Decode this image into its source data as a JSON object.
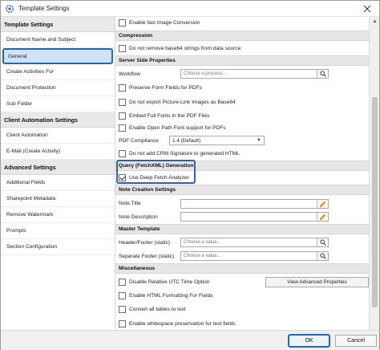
{
  "window": {
    "title": "Template Settings",
    "close_glyph": "✕"
  },
  "sidebar": {
    "sections": [
      {
        "title": "Template Settings",
        "items": [
          {
            "label": "Document Name and Subject",
            "selected": false
          },
          {
            "label": "General",
            "selected": true
          },
          {
            "label": "Create Activities For",
            "selected": false
          },
          {
            "label": "Document Protection",
            "selected": false
          },
          {
            "label": "Sub Folder",
            "selected": false
          }
        ]
      },
      {
        "title": "Client Automation Settings",
        "items": [
          {
            "label": "Client Automation",
            "selected": false
          },
          {
            "label": "E-Mail (Create Activity)",
            "selected": false
          }
        ]
      },
      {
        "title": "Advanced Settings",
        "items": [
          {
            "label": "Additional Fields",
            "selected": false
          },
          {
            "label": "Sharepoint Metadata",
            "selected": false
          },
          {
            "label": "Remove Watermark",
            "selected": false
          },
          {
            "label": "Prompts",
            "selected": false
          },
          {
            "label": "Section Configuration",
            "selected": false
          }
        ]
      }
    ]
  },
  "main": {
    "top_options": {
      "fast_image_conversion": {
        "label": "Enable fast Image Conversion",
        "checked": false
      }
    },
    "compression": {
      "title": "Compression",
      "no_remove_base64": {
        "label": "Do not remove base64 strings from data source",
        "checked": false
      }
    },
    "server_side": {
      "title": "Server Side Properties",
      "workflow_label": "Workflow",
      "workflow_placeholder": "Choose a process...",
      "preserve_form_fields": {
        "label": "Preserve Form Fields for PDFs",
        "checked": false
      },
      "no_export_picture_link": {
        "label": "Do not export Picture-Link Images as Base64",
        "checked": false
      },
      "embed_fonts": {
        "label": "Embed Full Fonts in the PDF Files",
        "checked": false
      },
      "open_path_font": {
        "label": "Enable Open Path Font support for PDFs",
        "checked": false
      },
      "pdf_compliance_label": "PDF Compliance",
      "pdf_compliance_value": "1.4 (Default)",
      "no_crm_signature": {
        "label": "Do not add CRM Signature to generated HTML",
        "checked": false
      }
    },
    "query": {
      "title": "Query (FetchXML) Generation",
      "deep_fetch": {
        "label": "Use Deep Fetch Analyzer",
        "checked": true
      }
    },
    "note_creation": {
      "title": "Note Creation Settings",
      "note_title_label": "Note Title",
      "note_description_label": "Note Description"
    },
    "master_template": {
      "title": "Master Template",
      "header_footer_label": "Header/Footer (static)",
      "header_footer_placeholder": "Choose a value...",
      "separate_footer_label": "Separate Footer (static)",
      "separate_footer_placeholder": "Choose a value..."
    },
    "misc": {
      "title": "Miscellaneous",
      "disable_utc": {
        "label": "Disable Relative UTC Time Option",
        "checked": false
      },
      "view_advanced_button": "View Advanced Properties",
      "html_formatting": {
        "label": "Enable HTML Formatting For Fields",
        "checked": false
      },
      "convert_tables": {
        "label": "Convert all tables to text",
        "checked": false
      },
      "whitespace": {
        "label": "Enable whitespace preservation for text fields",
        "checked": false
      }
    }
  },
  "footer": {
    "ok_label": "OK",
    "cancel_label": "Cancel"
  },
  "colors": {
    "accent": "#2a64b4",
    "selected_bg": "#cfe3f7",
    "section_bg": "#e6e6e6"
  },
  "icons": {
    "app": "gear-circle-icon",
    "search": "search-icon",
    "pencil": "pencil-icon",
    "dropdown": "chevron-down-icon"
  }
}
